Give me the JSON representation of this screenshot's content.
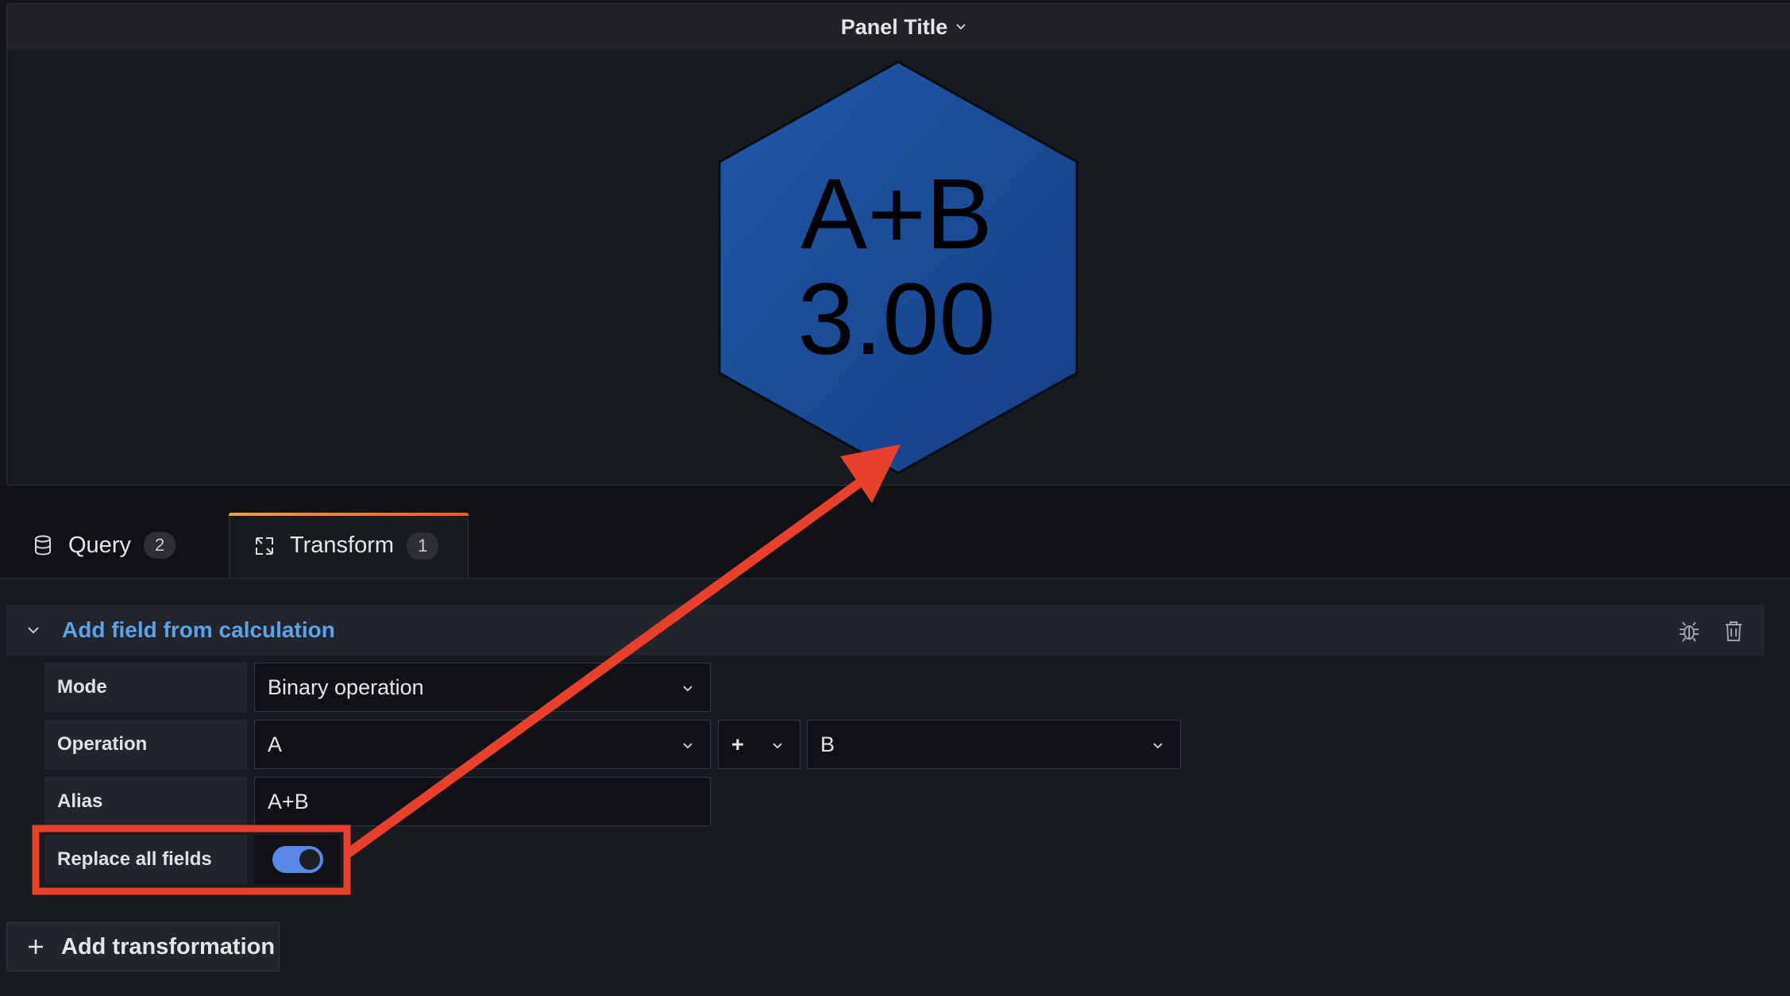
{
  "panel": {
    "title": "Panel Title",
    "stat": {
      "name": "A+B",
      "value": "3.00",
      "fill_start": "#1f5aa8",
      "fill_end": "#153e86"
    }
  },
  "tabs": [
    {
      "label": "Query",
      "count": "2",
      "icon": "database-icon"
    },
    {
      "label": "Transform",
      "count": "1",
      "icon": "transform-icon"
    }
  ],
  "transformation": {
    "title": "Add field from calculation",
    "mode": {
      "label": "Mode",
      "value": "Binary operation"
    },
    "operation": {
      "label": "Operation",
      "left": "A",
      "operator": "+",
      "right": "B"
    },
    "alias": {
      "label": "Alias",
      "value": "A+B"
    },
    "replace_all": {
      "label": "Replace all fields",
      "enabled": true
    }
  },
  "add_transformation": {
    "label": "Add transformation"
  },
  "colors": {
    "accent": "#5ba2e9",
    "annotation": "#e8402b",
    "toggle_on": "#5a88e6"
  }
}
